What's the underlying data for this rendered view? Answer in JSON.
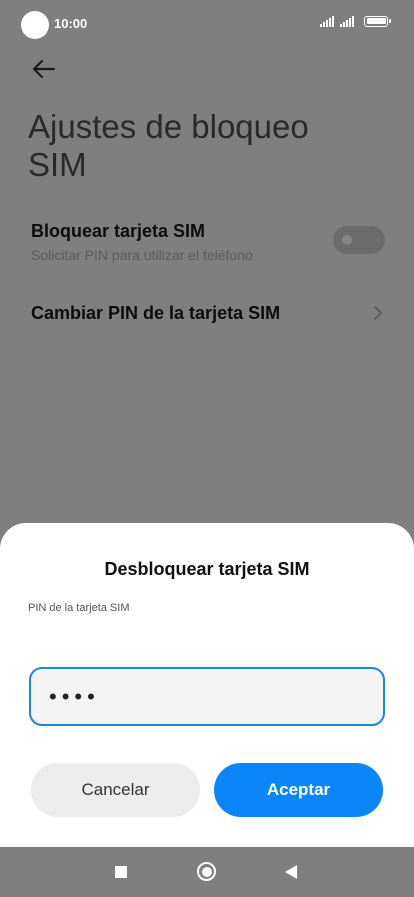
{
  "status_bar": {
    "time": "10:00"
  },
  "page": {
    "title": "Ajustes de bloqueo SIM",
    "lock_row": {
      "title": "Bloquear tarjeta SIM",
      "subtitle": "Solicitar PIN para utilizar el teléfono",
      "toggle_on": false
    },
    "change_pin_row": {
      "title": "Cambiar PIN de la tarjeta SIM"
    }
  },
  "dialog": {
    "title": "Desbloquear tarjeta SIM",
    "field_label": "PIN de la tarjeta SIM",
    "pin_value": "••••",
    "cancel_label": "Cancelar",
    "accept_label": "Aceptar"
  },
  "icons": {
    "back": "arrow-left-icon",
    "chevron": "chevron-right-icon",
    "nav_recents": "square-icon",
    "nav_home": "circle-icon",
    "nav_back": "triangle-left-icon"
  },
  "colors": {
    "accent": "#0a86f8",
    "input_border": "#1b88d6",
    "scrim": "#7f7f7f"
  }
}
